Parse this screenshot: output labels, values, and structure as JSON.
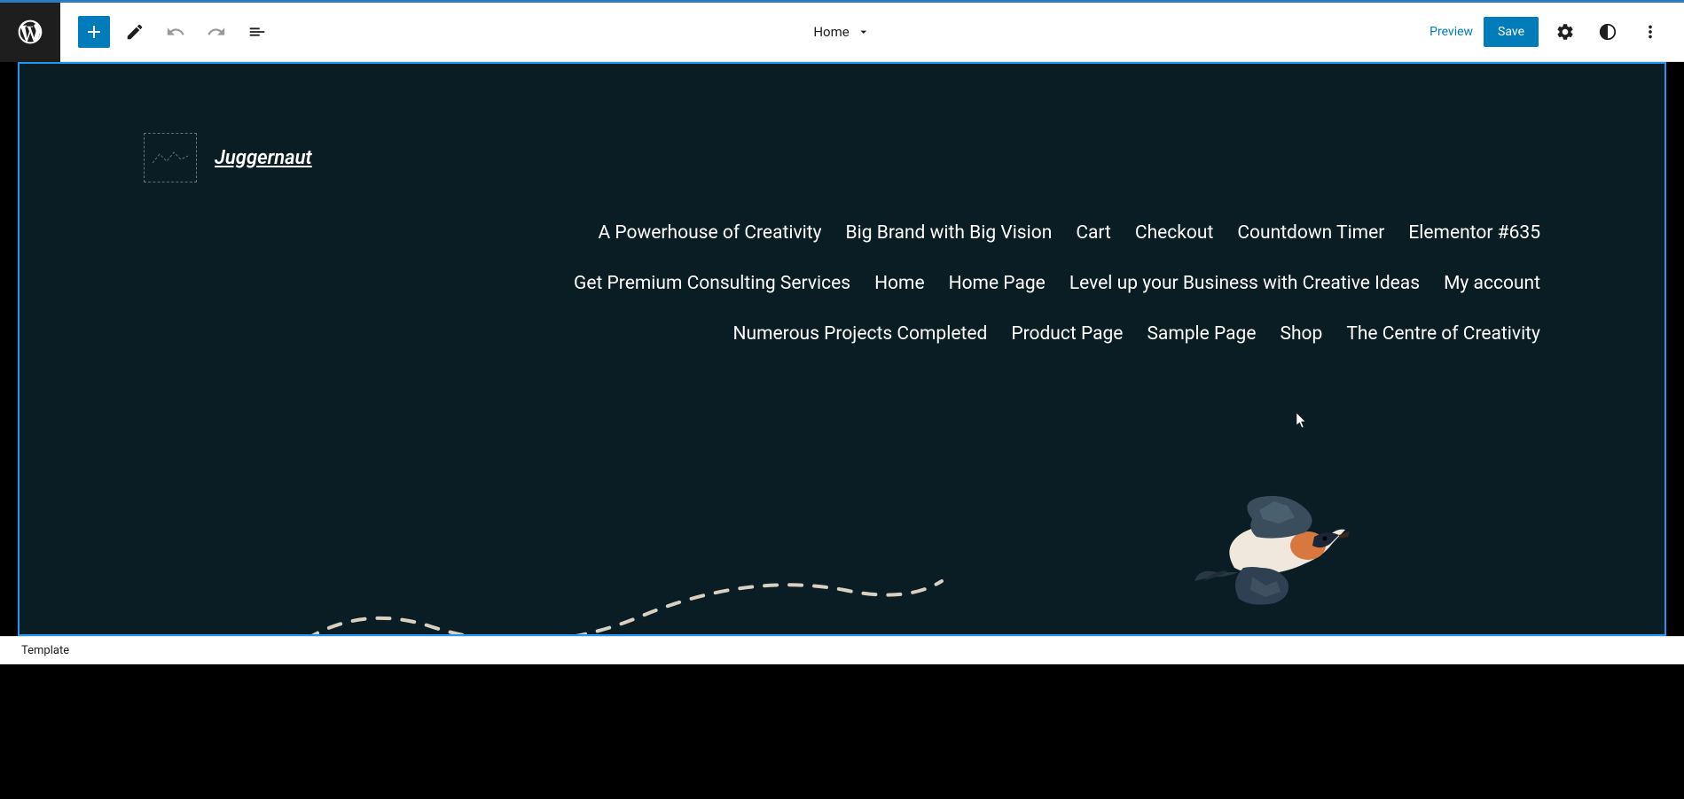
{
  "toolbar": {
    "page_title": "Home",
    "preview_label": "Preview",
    "save_label": "Save"
  },
  "site": {
    "title": "Juggernaut"
  },
  "nav": {
    "items": [
      "A Powerhouse of Creativity",
      "Big Brand with Big Vision",
      "Cart",
      "Checkout",
      "Countdown Timer",
      "Elementor #635",
      "Get Premium Consulting Services",
      "Home",
      "Home Page",
      "Level up your Business with Creative Ideas",
      "My account",
      "Numerous Projects Completed",
      "Product Page",
      "Sample Page",
      "Shop",
      "The Centre of Creativity"
    ]
  },
  "breadcrumb": {
    "label": "Template"
  }
}
